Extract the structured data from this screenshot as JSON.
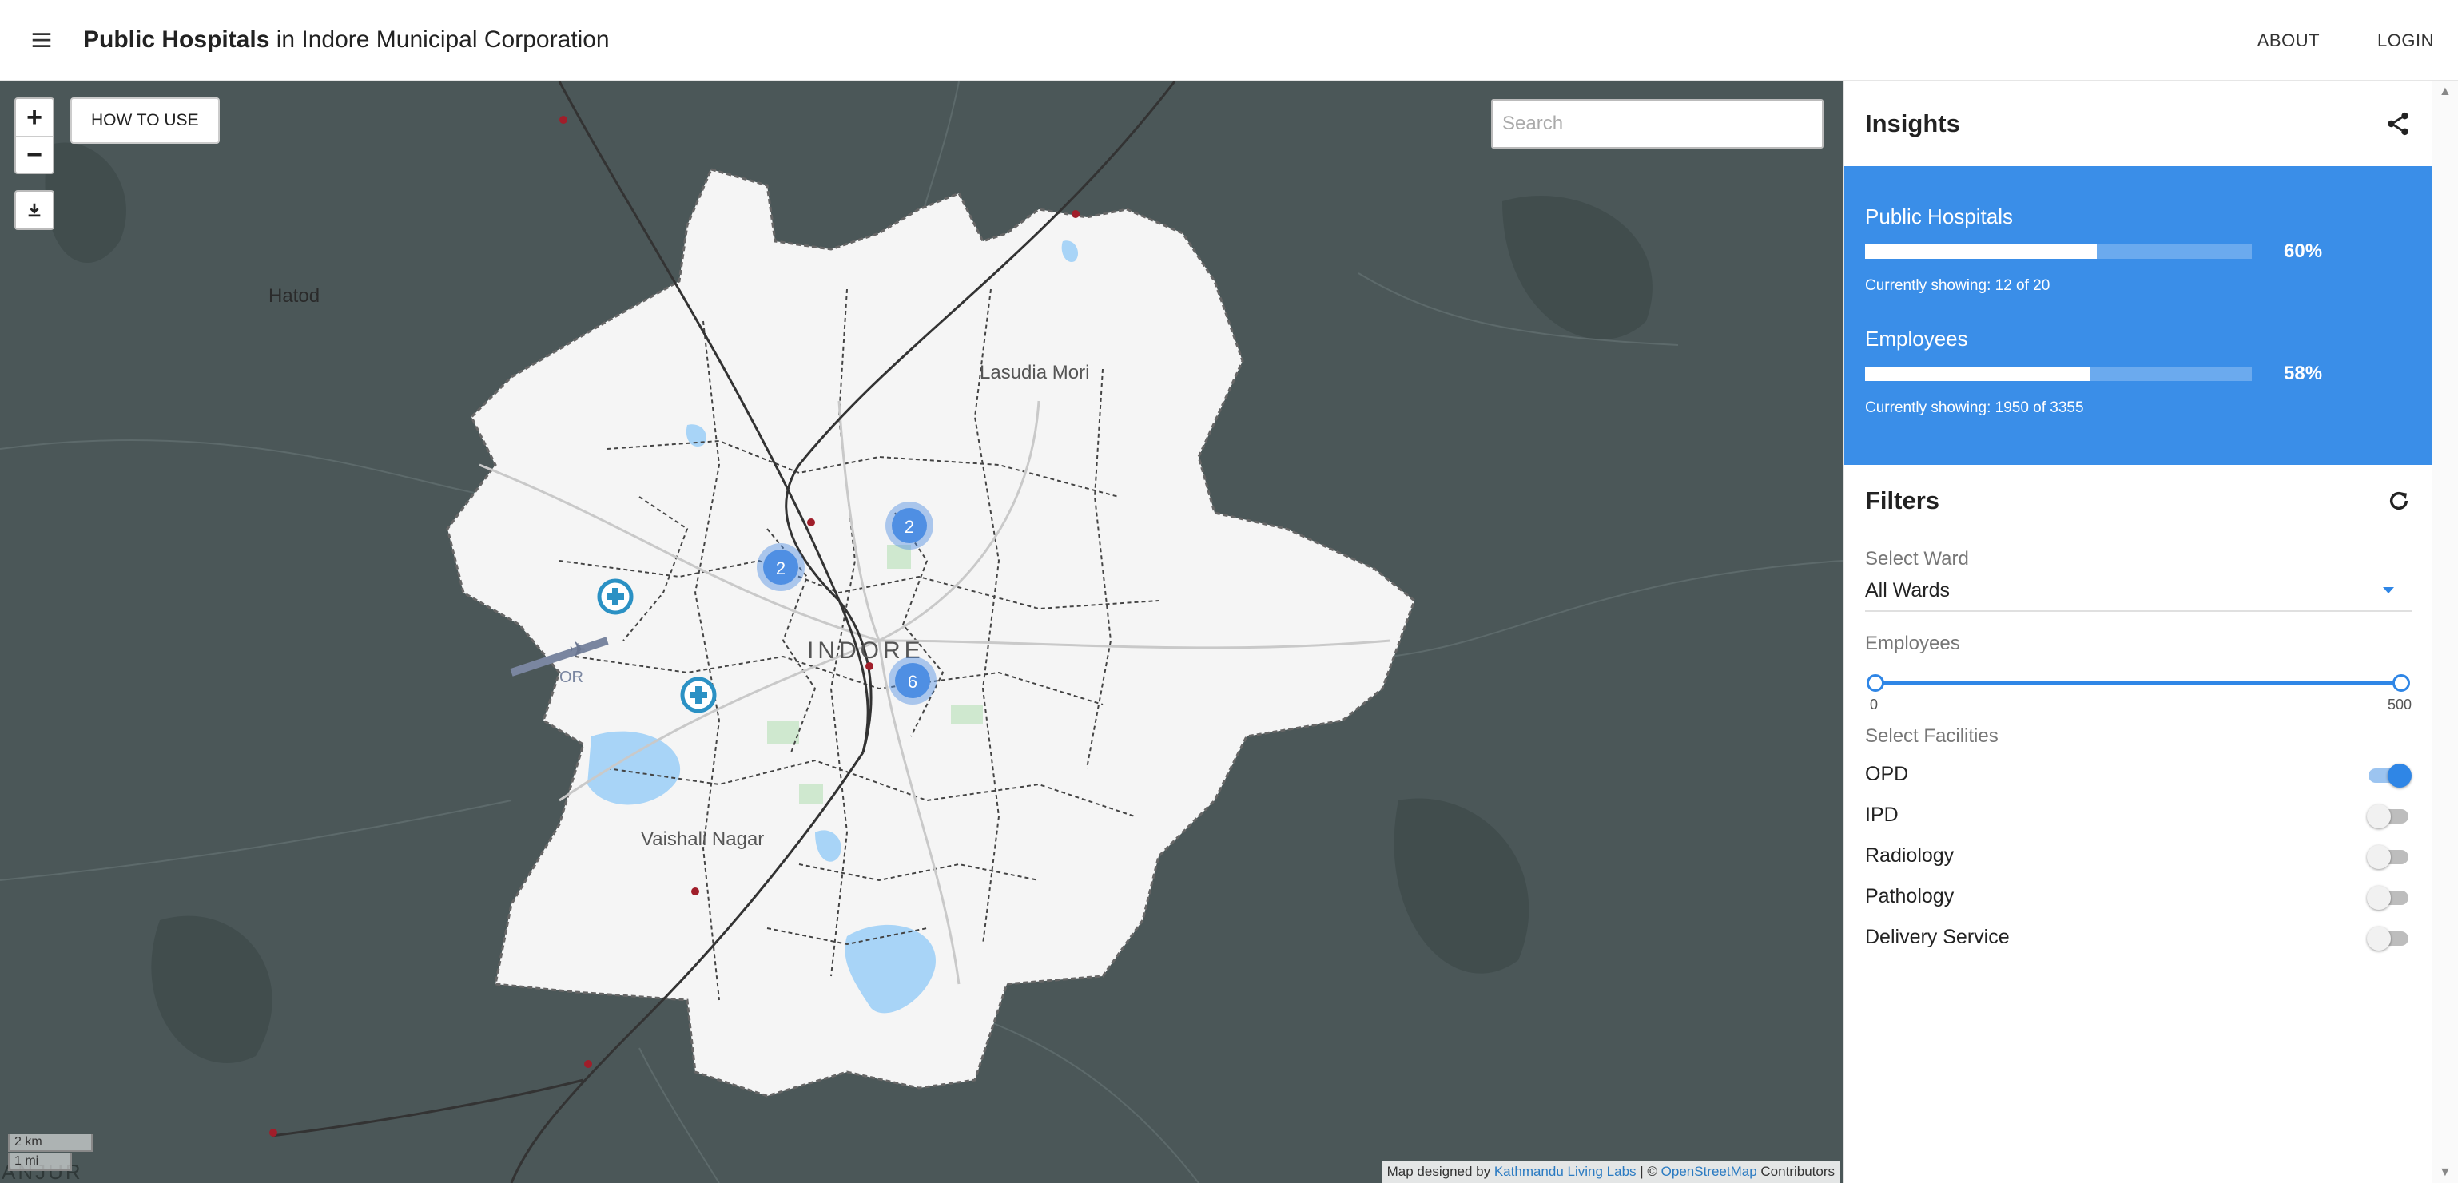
{
  "header": {
    "title_bold": "Public Hospitals",
    "title_rest": " in Indore Municipal Corporation",
    "about_label": "ABOUT",
    "login_label": "LOGIN"
  },
  "map": {
    "zoom_in": "+",
    "zoom_out": "−",
    "how_to_use_label": "HOW TO USE",
    "search_placeholder": "Search",
    "scale_km": "2 km",
    "scale_mi": "1 mi",
    "attribution_prefix": "Map designed by ",
    "attribution_kll": "Kathmandu Living Labs",
    "attribution_mid": " | © ",
    "attribution_osm": "OpenStreetMap",
    "attribution_suffix": " Contributors",
    "place_labels": [
      "Hatod",
      "Lasudia Mori",
      "INDORE",
      "Vaishali Nagar",
      "OR",
      "ANJUR"
    ],
    "clusters": [
      "2",
      "2",
      "6"
    ],
    "hospital_marker_count": 2,
    "colors": {
      "background": "#4b5758",
      "city_area": "#f5f5f5",
      "water": "#a8d4f7",
      "cluster": "#4f8fe3",
      "marker": "#2b91c4"
    }
  },
  "insights": {
    "title": "Insights",
    "metrics": [
      {
        "label": "Public Hospitals",
        "pct_text": "60%",
        "fraction": 0.6,
        "sub": "Currently showing: 12 of 20"
      },
      {
        "label": "Employees",
        "pct_text": "58%",
        "fraction": 0.58,
        "sub": "Currently showing: 1950 of 3355"
      }
    ],
    "panel_color": "#3a8ee8"
  },
  "filters": {
    "title": "Filters",
    "ward_label": "Select Ward",
    "ward_value": "All Wards",
    "employees_label": "Employees",
    "employees_min": "0",
    "employees_max": "500",
    "facilities_label": "Select Facilities",
    "facilities": [
      {
        "label": "OPD",
        "on": true
      },
      {
        "label": "IPD",
        "on": false
      },
      {
        "label": "Radiology",
        "on": false
      },
      {
        "label": "Pathology",
        "on": false
      },
      {
        "label": "Delivery Service",
        "on": false
      }
    ]
  }
}
